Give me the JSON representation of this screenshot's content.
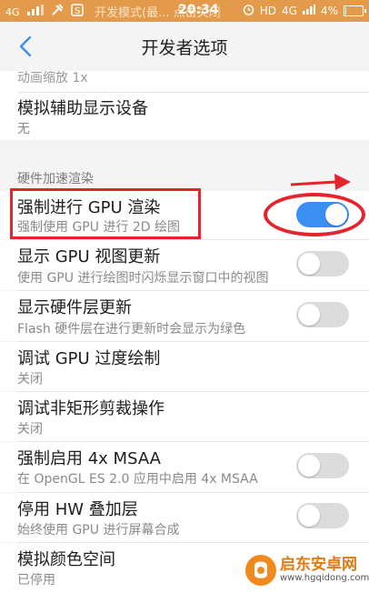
{
  "status_bar": {
    "signal": "4G",
    "notice": "开发模式(最... 点击关闭",
    "time": "20:34",
    "network": "HD",
    "network2": "4G",
    "battery_percent": "4%",
    "battery_level": 0.04
  },
  "header": {
    "title": "开发者选项"
  },
  "rows": [
    {
      "title": "动画缩放 1x"
    },
    {
      "title": "模拟辅助显示设备",
      "subtitle": "无"
    },
    {
      "section": "硬件加速渲染"
    },
    {
      "title": "强制进行 GPU 渲染",
      "subtitle": "强制使用 GPU 进行 2D 绘图",
      "toggle": true
    },
    {
      "title": "显示 GPU 视图更新",
      "subtitle": "使用 GPU 进行绘图时闪烁显示窗口中的视图",
      "toggle": false
    },
    {
      "title": "显示硬件层更新",
      "subtitle": "Flash 硬件层在进行更新时会显示为绿色",
      "toggle": false
    },
    {
      "title": "调试 GPU 过度绘制",
      "subtitle": "关闭"
    },
    {
      "title": "调试非矩形剪裁操作",
      "subtitle": "关闭"
    },
    {
      "title": "强制启用 4x MSAA",
      "subtitle": "在 OpenGL ES 2.0 应用中启用 4x MSAA",
      "toggle": false
    },
    {
      "title": "停用 HW 叠加层",
      "subtitle": "始终使用 GPU 进行屏幕合成",
      "toggle": false
    },
    {
      "title": "模拟颜色空间",
      "subtitle": "已停用"
    }
  ],
  "watermark": {
    "name": "启东安卓网",
    "url": "www.hgqidong.com"
  },
  "colors": {
    "status_bar": "#e39a4a",
    "toggle_on": "#3b8ff2",
    "toggle_off": "#dcdcdc",
    "annotation_red": "#e6232d",
    "back_icon": "#3b8ff2"
  }
}
